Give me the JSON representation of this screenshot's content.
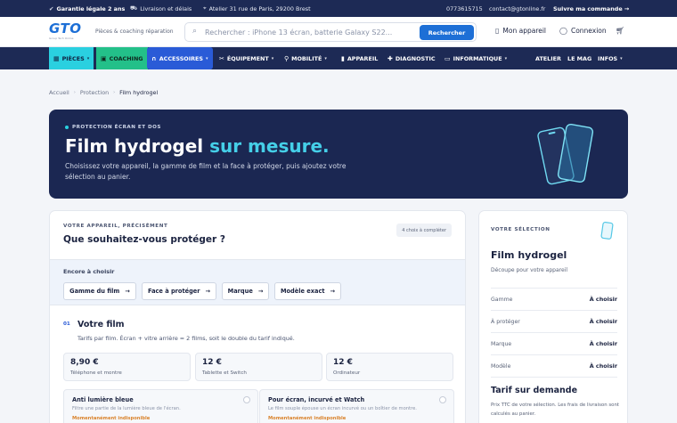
{
  "topbar": {
    "guarantee": "Garantie légale 2 ans",
    "delivery": "Livraison et délais",
    "address": "Atelier 31 rue de Paris, 29200 Brest",
    "phone": "0773615715",
    "email": "contact@gtonline.fr",
    "track": "Suivre ma commande →"
  },
  "header": {
    "logo": "GTO",
    "logo_sub": "Group Tech Online",
    "tagline": "Pièces & coaching réparation",
    "search_placeholder": "Rechercher : iPhone 13 écran, batterie Galaxy S22...",
    "search_button": "Rechercher",
    "my_device": "Mon appareil",
    "login": "Connexion"
  },
  "nav": {
    "items": [
      "PIÈCES",
      "COACHING",
      "ACCESSOIRES",
      "ÉQUIPEMENT",
      "MOBILITÉ",
      "APPAREIL",
      "DIAGNOSTIC",
      "INFORMATIQUE"
    ],
    "right": [
      "ATELIER",
      "LE MAG",
      "INFOS"
    ]
  },
  "breadcrumb": [
    "Accueil",
    "Protection",
    "Film hydrogel"
  ],
  "hero": {
    "eyebrow": "PROTECTION ÉCRAN ET DOS",
    "title_main": "Film hydrogel ",
    "title_accent": "sur mesure.",
    "description": "Choisissez votre appareil, la gamme de film et la face à protéger, puis ajoutez votre sélection au panier."
  },
  "config": {
    "eyebrow": "VOTRE APPAREIL, PRÉCISÉMENT",
    "title": "Que souhaitez-vous protéger ?",
    "badge": "4 choix à compléter",
    "choose_label": "Encore à choisir",
    "chips": [
      "Gamme du film",
      "Face à protéger",
      "Marque",
      "Modèle exact"
    ],
    "chip_arrow": "→",
    "step_number": "01",
    "step_title": "Votre film",
    "step_sub": "Tarifs par film. Écran + vitre arrière = 2 films, soit le double du tarif indiqué.",
    "prices": [
      {
        "value": "8,90 €",
        "label": "Téléphone et montre"
      },
      {
        "value": "12 €",
        "label": "Tablette et Switch"
      },
      {
        "value": "12 €",
        "label": "Ordinateur"
      }
    ],
    "options": [
      {
        "title": "Anti lumière bleue",
        "desc": "Filtre une partie de la lumière bleue de l'écran.",
        "status": "Momentanément indisponible"
      },
      {
        "title": "Pour écran, incurvé et Watch",
        "desc": "Le film souple épouse un écran incurvé ou un boîtier de montre.",
        "status": "Momentanément indisponible"
      }
    ]
  },
  "summary": {
    "eyebrow": "VOTRE SÉLECTION",
    "title": "Film hydrogel",
    "subtitle": "Découpe pour votre appareil",
    "rows": [
      {
        "key": "Gamme",
        "value": "À choisir"
      },
      {
        "key": "À protéger",
        "value": "À choisir"
      },
      {
        "key": "Marque",
        "value": "À choisir"
      },
      {
        "key": "Modèle",
        "value": "À choisir"
      }
    ],
    "price_title": "Tarif sur demande",
    "price_note": "Prix TTC de votre sélection. Les frais de livraison sont calculés au panier."
  },
  "colors": {
    "navy": "#1d2a55",
    "accent_blue": "#1d6fd6",
    "cyan": "#2ad0e0",
    "green": "#23c089",
    "warning": "#d9822b"
  }
}
